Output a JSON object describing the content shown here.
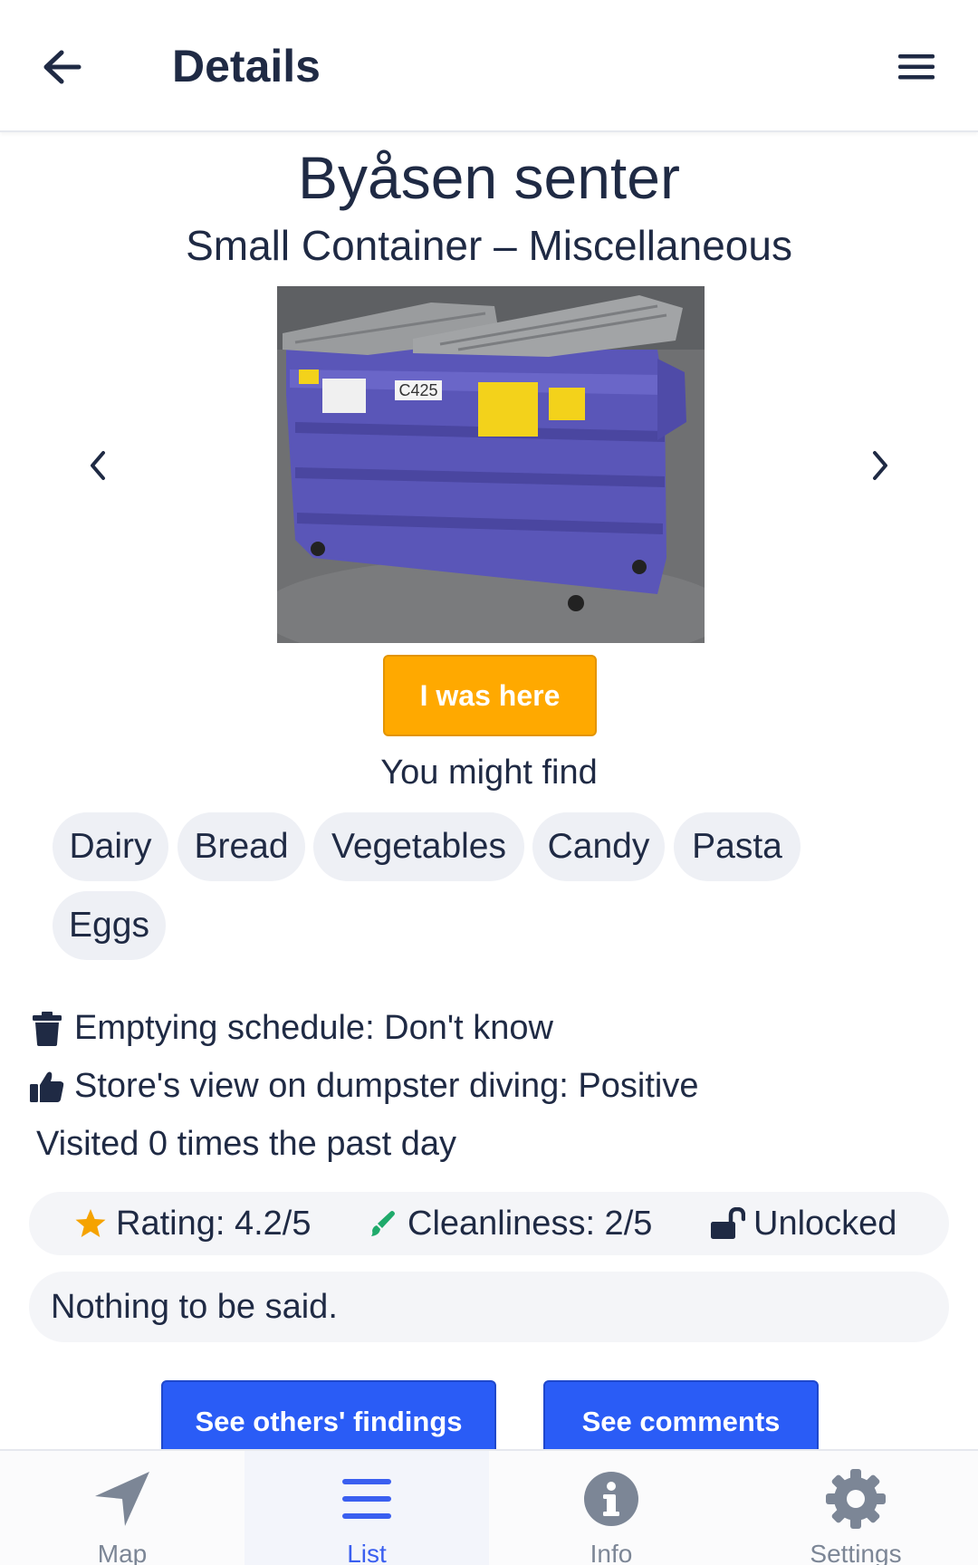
{
  "header": {
    "title": "Details",
    "back_icon": "arrow-left-icon",
    "menu_icon": "hamburger-menu-icon"
  },
  "store": {
    "name": "Byåsen senter",
    "container": "Small Container – Miscellaneous"
  },
  "carousel": {
    "prev_icon": "chevron-left-icon",
    "next_icon": "chevron-right-icon",
    "photo_label": "C425"
  },
  "was_here_label": "I was here",
  "might_find_title": "You might find",
  "tags": [
    "Dairy",
    "Bread",
    "Vegetables",
    "Candy",
    "Pasta",
    "Eggs"
  ],
  "info": {
    "emptying": "Emptying schedule: Don't know",
    "store_view": "Store's view on dumpster diving: Positive",
    "visited": "Visited 0 times the past day"
  },
  "stats": {
    "rating": "Rating: 4.2/5",
    "cleanliness": "Cleanliness: 2/5",
    "lock": "Unlocked"
  },
  "comment": "Nothing to be said.",
  "buttons": {
    "others_findings": "See others' findings",
    "comments": "See comments"
  },
  "nav": [
    {
      "label": "Map",
      "icon": "navigation-arrow-icon",
      "active": false
    },
    {
      "label": "List",
      "icon": "list-icon",
      "active": true
    },
    {
      "label": "Info",
      "icon": "info-icon",
      "active": false
    },
    {
      "label": "Settings",
      "icon": "gear-icon",
      "active": false
    }
  ],
  "colors": {
    "primary_text": "#1f2a44",
    "accent_orange": "#ffa900",
    "accent_blue": "#2a5cf6",
    "chip_bg": "#eef0f5",
    "star": "#f5a300",
    "brush": "#1faa6b",
    "nav_active": "#3a5ff0",
    "nav_inactive": "#7c8696"
  }
}
